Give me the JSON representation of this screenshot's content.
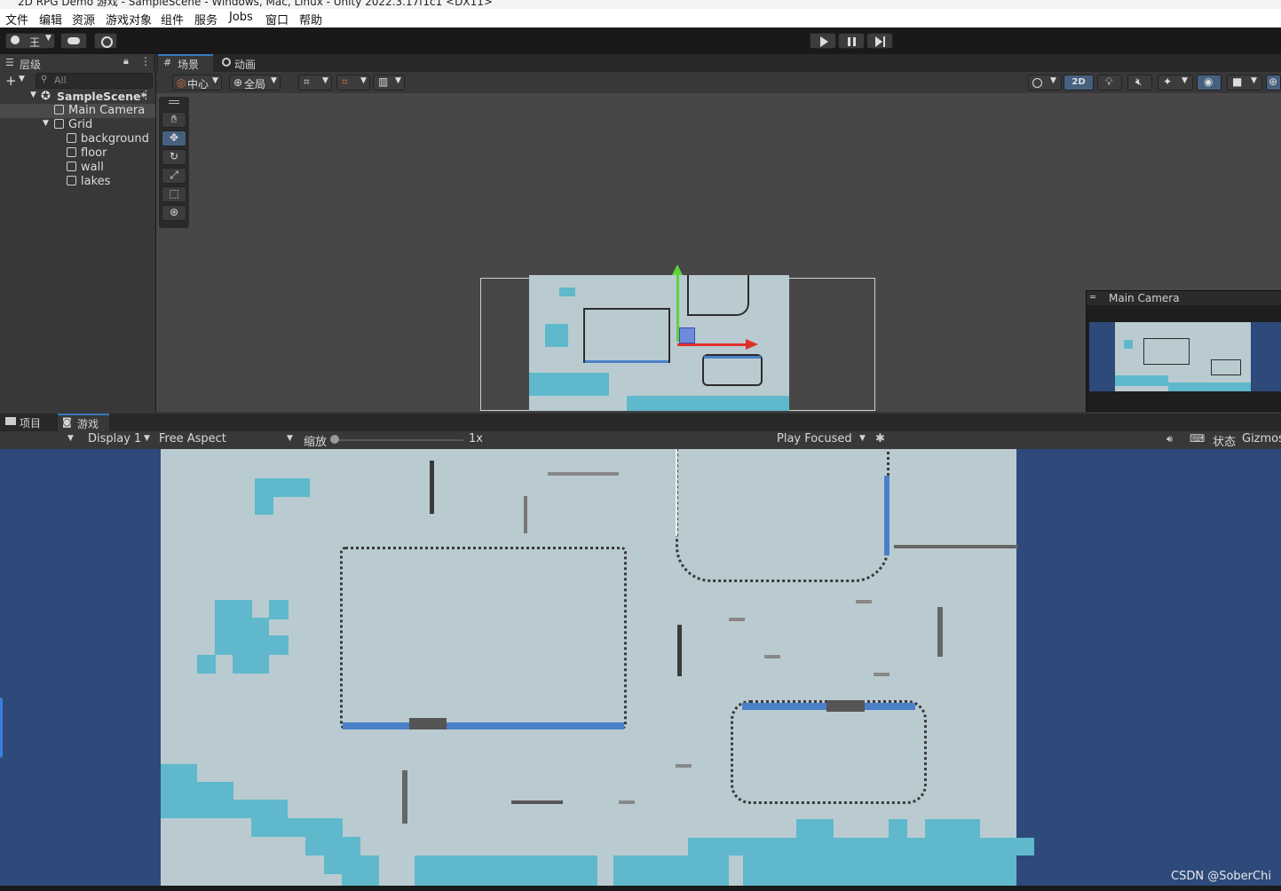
{
  "window": {
    "title": "2D RPG Demo 游戏 - SampleScene - Windows, Mac, Linux - Unity 2022.3.17f1c1 <DX11>"
  },
  "menu": [
    "文件",
    "编辑",
    "资源",
    "游戏对象",
    "组件",
    "服务",
    "Jobs",
    "窗口",
    "帮助"
  ],
  "toolbar": {
    "account": "王"
  },
  "hierarchy": {
    "tab": "层级",
    "search_placeholder": "All",
    "scene": "SampleScene*",
    "items": [
      "Main Camera",
      "Grid",
      "background",
      "floor",
      "wall",
      "lakes"
    ]
  },
  "scene": {
    "tabs": [
      "场景",
      "动画"
    ],
    "pivot": "中心",
    "global": "全局",
    "mode2d": "2D"
  },
  "camera_preview": {
    "title": "Main Camera"
  },
  "game": {
    "tabs": [
      "项目",
      "游戏"
    ],
    "display": "Display 1",
    "aspect": "Free Aspect",
    "scale_label": "缩放",
    "scale_value": "1x",
    "play_mode": "Play Focused",
    "stats": "状态",
    "gizmos": "Gizmos"
  },
  "watermark": "CSDN @SoberChi",
  "colors": {
    "water": "#5fb8cc",
    "ground": "#b9cbd0",
    "wall_blue": "#4a80c8",
    "game_bg": "#2e4a7a"
  }
}
